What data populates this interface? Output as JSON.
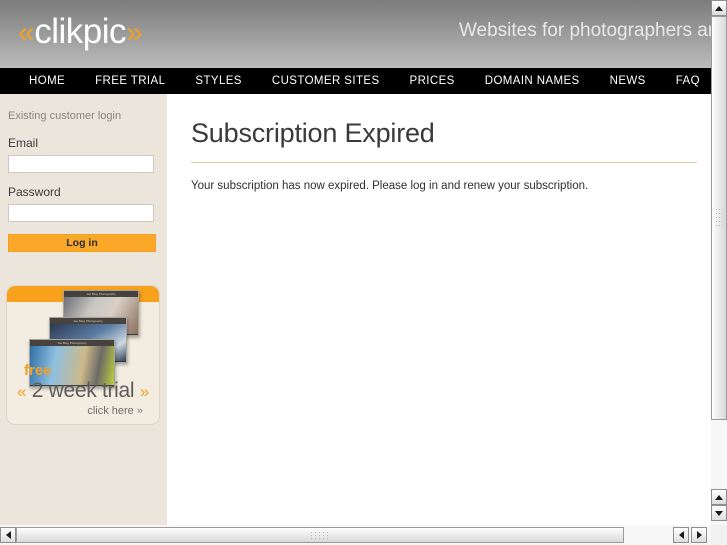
{
  "header": {
    "logo_left_guillemet": "«",
    "logo_text": "clikpic",
    "logo_right_guillemet": "»",
    "tagline": "Websites for photographers and",
    "logo_accent_color": "#f2a024"
  },
  "nav": {
    "items": [
      {
        "label": "HOME"
      },
      {
        "label": "FREE TRIAL"
      },
      {
        "label": "STYLES"
      },
      {
        "label": "CUSTOMER SITES"
      },
      {
        "label": "PRICES"
      },
      {
        "label": "DOMAIN NAMES"
      },
      {
        "label": "NEWS"
      },
      {
        "label": "FAQ"
      }
    ]
  },
  "sidebar": {
    "login": {
      "note": "Existing customer login",
      "email_label": "Email",
      "email_value": "",
      "email_placeholder": "",
      "password_label": "Password",
      "password_value": "",
      "password_placeholder": "",
      "submit_label": "Log in",
      "button_color": "#f9a927"
    },
    "promo": {
      "free_text": "free",
      "left_guillemet": "«",
      "main_text": "2 week trial",
      "right_guillemet": "»",
      "click_text": "click here",
      "click_guillemet": "»",
      "accent_color": "#f2a024",
      "thumbnails": [
        {
          "caption": "Joe Blog Photography"
        },
        {
          "caption": "Joe Blog Photography"
        },
        {
          "caption": "Joe Blog Photography"
        }
      ]
    }
  },
  "main": {
    "title": "Subscription Expired",
    "body": "Your subscription has now expired. Please log in and renew your subscription."
  },
  "scrollbars": {
    "vertical": {
      "up_icon": "triangle-up",
      "down_icon": "triangle-down"
    },
    "horizontal": {
      "left_icon": "triangle-left",
      "right_icon": "triangle-right"
    }
  }
}
